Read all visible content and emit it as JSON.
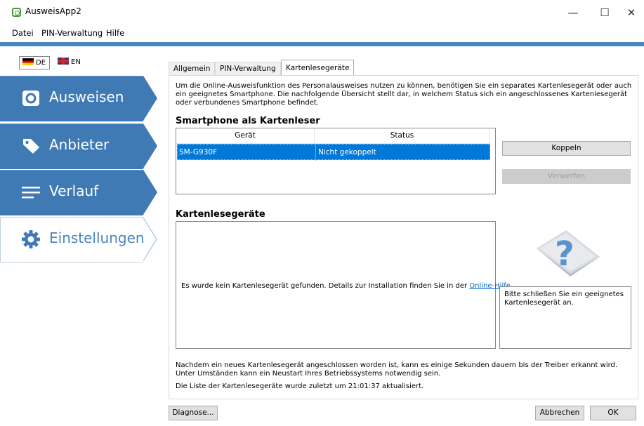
{
  "window": {
    "title": "AusweisApp2",
    "minimize": "—",
    "maximize": "☐",
    "close": "✕"
  },
  "menu": [
    {
      "label": "Datei"
    },
    {
      "label": "PIN-Verwaltung"
    },
    {
      "label": "Hilfe"
    }
  ],
  "languages": {
    "de": "DE",
    "en": "EN"
  },
  "nav": {
    "items": [
      {
        "label": "Ausweisen",
        "icon": "id-card-icon"
      },
      {
        "label": "Anbieter",
        "icon": "tag-icon"
      },
      {
        "label": "Verlauf",
        "icon": "list-icon"
      },
      {
        "label": "Einstellungen",
        "icon": "gear-icon",
        "active": true
      }
    ]
  },
  "tabs": [
    {
      "label": "Allgemein"
    },
    {
      "label": "PIN-Verwaltung"
    },
    {
      "label": "Kartenlesegeräte",
      "active": true
    }
  ],
  "intro": "Um die Online-Ausweisfunktion des Personalausweises nutzen zu können, benötigen Sie ein separates Kartenlesegerät oder auch ein geeignetes Smartphone. Die nachfolgende Übersicht stellt dar, in welchem Status sich ein angeschlossenes Kartenlesegerät oder verbundenes Smartphone befindet.",
  "smartphone": {
    "title": "Smartphone als Kartenleser",
    "columns": [
      "Gerät",
      "Status"
    ],
    "rows": [
      {
        "device": "SM-G930F",
        "status": "Nicht gekoppelt"
      }
    ],
    "pair_button": "Koppeln",
    "discard_button": "Verwerfen"
  },
  "readers": {
    "title": "Kartenlesegeräte",
    "empty_text": "Es wurde kein Kartenlesegerät gefunden. Details zur Installation finden Sie in der",
    "help_link": "Online-Hilfe",
    "period": ".",
    "hint": "Bitte schließen Sie ein geeignetes Kartenlesegerät an.",
    "hint_icon": "question-card-icon"
  },
  "footer": {
    "info": "Nachdem ein neues Kartenlesegerät angeschlossen worden ist, kann es einige Sekunden dauern bis der Treiber erkannt wird. Unter Umständen kann ein Neustart Ihres Betriebssystems notwendig sein.",
    "updated": "Die Liste der Kartenlesegeräte wurde zuletzt um 21:01:37 aktualisiert."
  },
  "buttons": {
    "diagnose": "Diagnose...",
    "cancel": "Abbrechen",
    "ok": "OK"
  },
  "colors": {
    "accent": "#3f7ab5",
    "selection": "#0078d7",
    "link": "#0066cc"
  }
}
